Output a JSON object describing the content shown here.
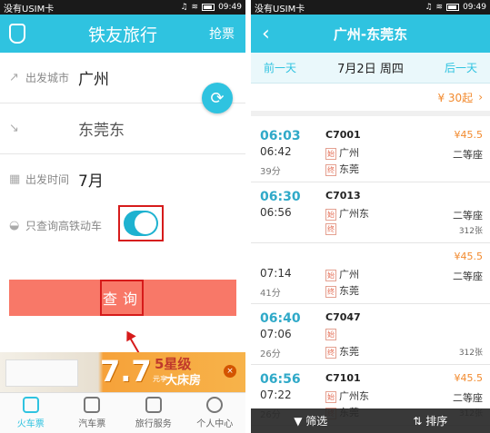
{
  "statusbar": {
    "carrier": "没有USIM卡",
    "time": "09:49"
  },
  "left_screen": {
    "app_title": "铁友旅行",
    "grab_ticket": "抢票",
    "rows": [
      {
        "label": "出发城市",
        "value": "广州"
      },
      {
        "label": "",
        "value": "东莞东"
      },
      {
        "label": "出发时间",
        "value": "7月"
      },
      {
        "label": "只查询高铁动车",
        "value": ""
      }
    ],
    "query_button": "查询",
    "banner": {
      "headline": "7.7",
      "stars": "5星级",
      "price_unit": "元享",
      "room": "大床房"
    },
    "tabs": [
      {
        "label": "火车票"
      },
      {
        "label": "汽车票"
      },
      {
        "label": "旅行服务"
      },
      {
        "label": "个人中心"
      }
    ]
  },
  "right_screen": {
    "route_title": "广州-东莞东",
    "prev_day": "前一天",
    "current_date": "7月2日 周四",
    "next_day": "后一天",
    "price_start": "¥ 30起",
    "trains": [
      {
        "dep": "06:03",
        "arr": "06:42",
        "duration": "39分",
        "number": "C7001",
        "from": "广州",
        "to": "东莞",
        "price": "¥45.5",
        "seat": "二等座",
        "remaining": ""
      },
      {
        "dep": "06:30",
        "arr": "06:56",
        "duration": "",
        "number": "C7013",
        "from": "广州东",
        "to": "",
        "price": "",
        "seat": "二等座",
        "remaining": "312张"
      },
      {
        "dep": "",
        "arr": "07:14",
        "duration": "41分",
        "number": "",
        "from": "广州",
        "to": "东莞",
        "price": "¥45.5",
        "seat": "二等座",
        "remaining": ""
      },
      {
        "dep": "06:40",
        "arr": "07:06",
        "duration": "26分",
        "number": "C7047",
        "from": "",
        "to": "东莞",
        "price": "",
        "seat": "",
        "remaining": "312张"
      },
      {
        "dep": "06:56",
        "arr": "07:22",
        "duration": "26分",
        "number": "C7101",
        "from": "广州东",
        "to": "东莞",
        "price": "¥45.5",
        "seat": "二等座",
        "remaining": "312张"
      }
    ],
    "filter_label": "筛选",
    "sort_label": "排序"
  },
  "colors": {
    "primary": "#2fc3e0",
    "query_button": "#f87868",
    "highlight_box": "#d61b1b",
    "price": "#f28a2e"
  }
}
